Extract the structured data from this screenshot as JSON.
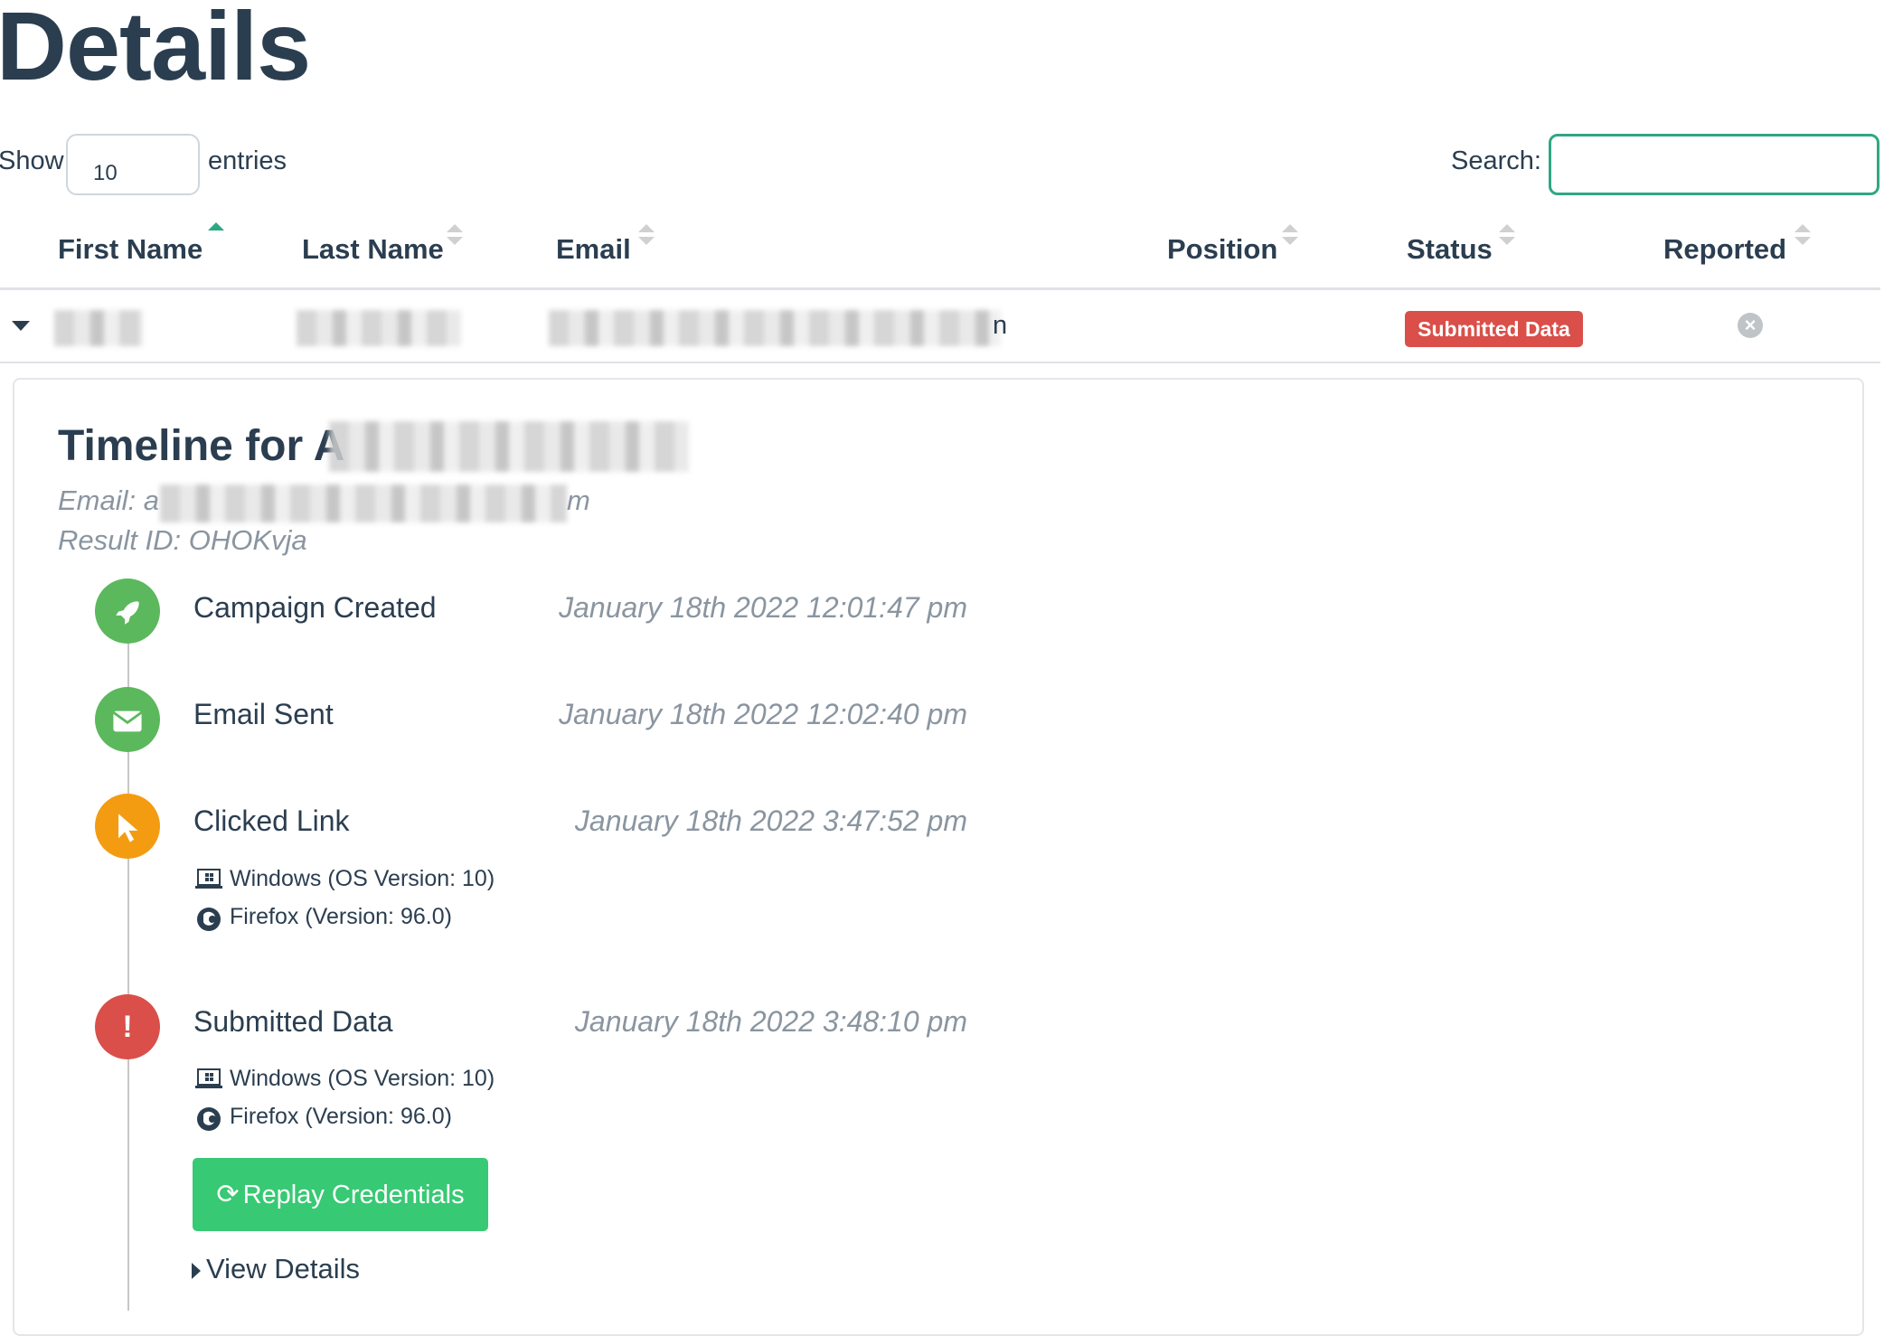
{
  "page": {
    "title": "Details"
  },
  "table_controls": {
    "show_label": "Show",
    "entries_value": "10",
    "entries_label": "entries",
    "search_label": "Search:",
    "search_value": ""
  },
  "table": {
    "columns": [
      {
        "label": "First Name",
        "sorted": "asc"
      },
      {
        "label": "Last Name",
        "sorted": "none"
      },
      {
        "label": "Email",
        "sorted": "none"
      },
      {
        "label": "Position",
        "sorted": "none"
      },
      {
        "label": "Status",
        "sorted": "none"
      },
      {
        "label": "Reported",
        "sorted": "none"
      }
    ],
    "row": {
      "email_suffix": "n",
      "status": "Submitted Data",
      "status_color": "#da4f49",
      "reported_icon": "circle-x-icon"
    }
  },
  "timeline": {
    "title_prefix": "Timeline for A",
    "email_prefix": "Email: a",
    "email_suffix": "m",
    "result_id": "Result ID: OHOKvja",
    "events": [
      {
        "name": "Campaign Created",
        "time": "January 18th 2022 12:01:47 pm",
        "icon": "rocket-icon",
        "color": "#5cb85c"
      },
      {
        "name": "Email Sent",
        "time": "January 18th 2022 12:02:40 pm",
        "icon": "envelope-icon",
        "color": "#5cb85c"
      },
      {
        "name": "Clicked Link",
        "time": "January 18th 2022 3:47:52 pm",
        "icon": "pointer-icon",
        "color": "#f39c12",
        "os": "Windows (OS Version: 10)",
        "browser": "Firefox (Version: 96.0)"
      },
      {
        "name": "Submitted Data",
        "time": "January 18th 2022 3:48:10 pm",
        "icon": "exclamation-icon",
        "color": "#da4f49",
        "os": "Windows (OS Version: 10)",
        "browser": "Firefox (Version: 96.0)"
      }
    ],
    "replay_button": "Replay Credentials",
    "view_details": "View Details"
  }
}
